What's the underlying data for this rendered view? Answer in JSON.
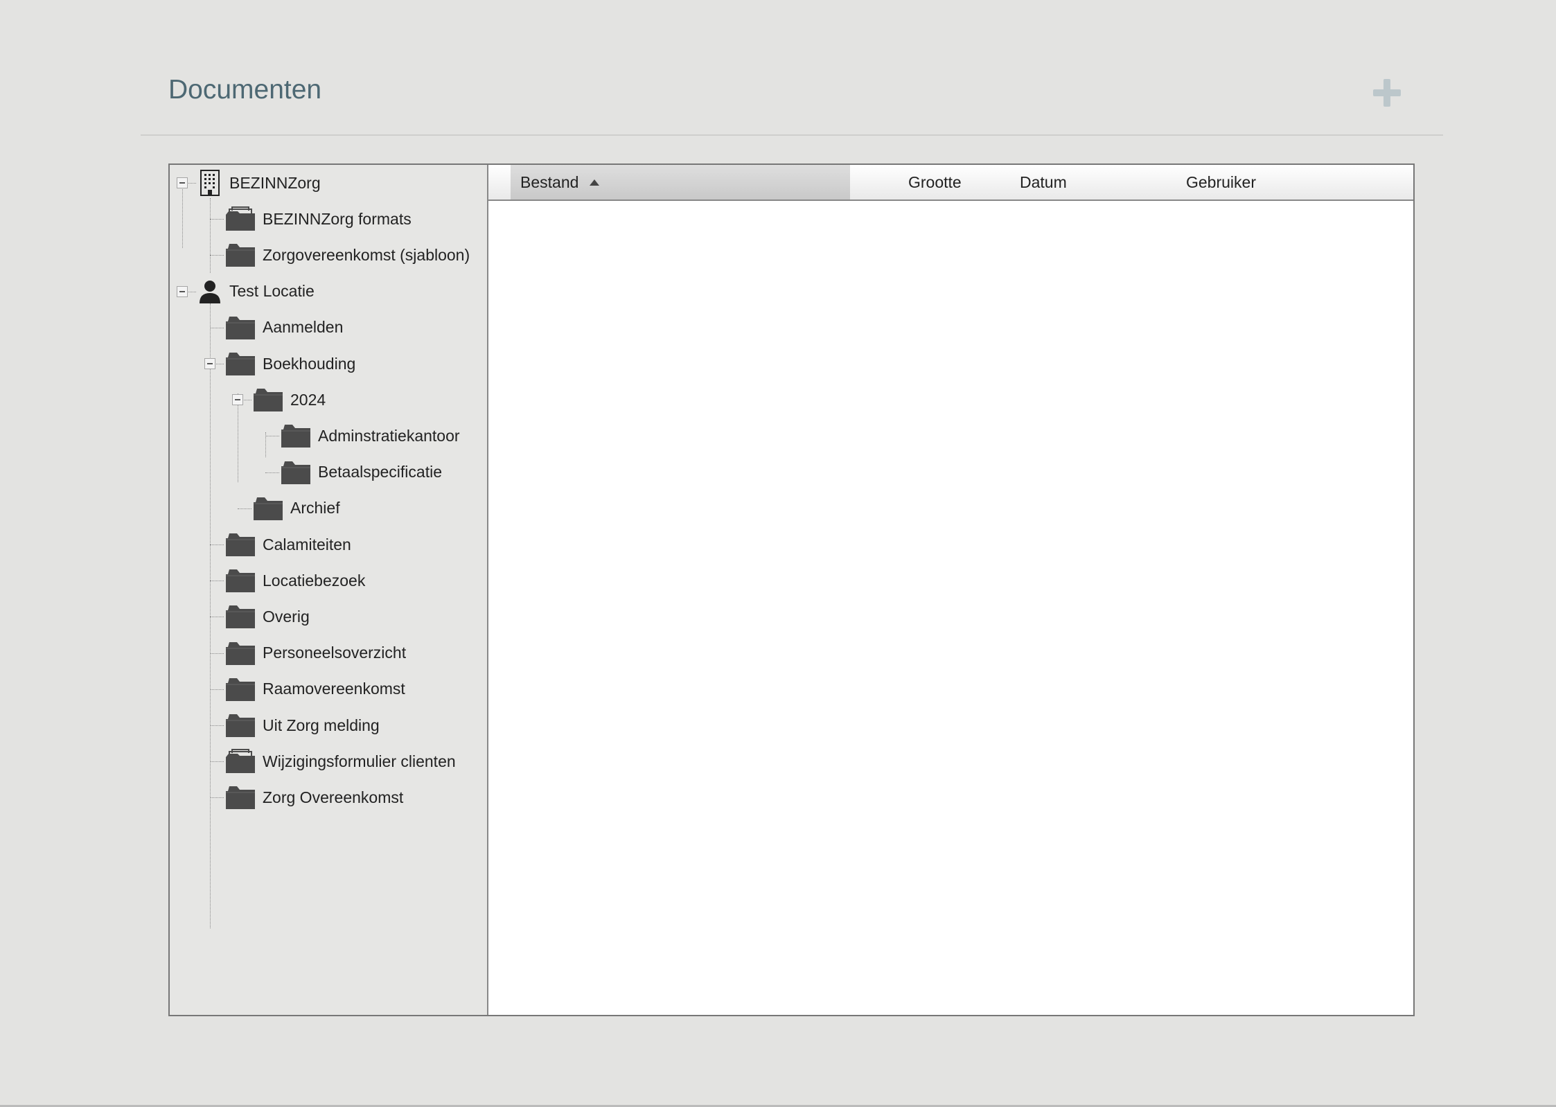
{
  "header": {
    "title": "Documenten",
    "add_icon": "plus-icon"
  },
  "tree": [
    {
      "id": "bezinnzorg",
      "label": "BEZINNZorg",
      "icon": "building-icon",
      "level": 0,
      "expanded": true
    },
    {
      "id": "bezinnzorg-formats",
      "label": "BEZINNZorg formats",
      "icon": "stacked-folder-icon",
      "level": 1
    },
    {
      "id": "zorgovereenkomst-sjabloon",
      "label": "Zorgovereenkomst (sjabloon)",
      "icon": "folder-icon",
      "level": 1
    },
    {
      "id": "test-locatie",
      "label": "Test Locatie",
      "icon": "person-icon",
      "level": 0,
      "expanded": true
    },
    {
      "id": "aanmelden",
      "label": "Aanmelden",
      "icon": "folder-icon",
      "level": 1
    },
    {
      "id": "boekhouding",
      "label": "Boekhouding",
      "icon": "folder-icon",
      "level": 1,
      "expanded": true
    },
    {
      "id": "2024",
      "label": "2024",
      "icon": "folder-icon",
      "level": 2,
      "expanded": true
    },
    {
      "id": "adminstratiekantoor",
      "label": "Adminstratiekantoor",
      "icon": "folder-icon",
      "level": 3
    },
    {
      "id": "betaalspecificatie",
      "label": "Betaalspecificatie",
      "icon": "folder-icon",
      "level": 3
    },
    {
      "id": "archief",
      "label": "Archief",
      "icon": "folder-icon",
      "level": 2
    },
    {
      "id": "calamiteiten",
      "label": "Calamiteiten",
      "icon": "folder-icon",
      "level": 1
    },
    {
      "id": "locatiebezoek",
      "label": "Locatiebezoek",
      "icon": "folder-icon",
      "level": 1
    },
    {
      "id": "overig",
      "label": "Overig",
      "icon": "folder-icon",
      "level": 1
    },
    {
      "id": "personeelsoverzicht",
      "label": "Personeelsoverzicht",
      "icon": "folder-icon",
      "level": 1
    },
    {
      "id": "raamovereenkomst",
      "label": "Raamovereenkomst",
      "icon": "folder-icon",
      "level": 1
    },
    {
      "id": "uit-zorg-melding",
      "label": "Uit Zorg melding",
      "icon": "folder-icon",
      "level": 1
    },
    {
      "id": "wijzigingsformulier-clienten",
      "label": "Wijzigingsformulier clienten",
      "icon": "stacked-folder-icon",
      "level": 1
    },
    {
      "id": "zorg-overeenkomst",
      "label": "Zorg Overeenkomst",
      "icon": "folder-icon",
      "level": 1
    }
  ],
  "grid": {
    "columns": [
      {
        "id": "bestand",
        "label": "Bestand",
        "sorted": "ascending"
      },
      {
        "id": "grootte",
        "label": "Grootte"
      },
      {
        "id": "datum",
        "label": "Datum"
      },
      {
        "id": "gebruiker",
        "label": "Gebruiker"
      }
    ],
    "rows": []
  }
}
